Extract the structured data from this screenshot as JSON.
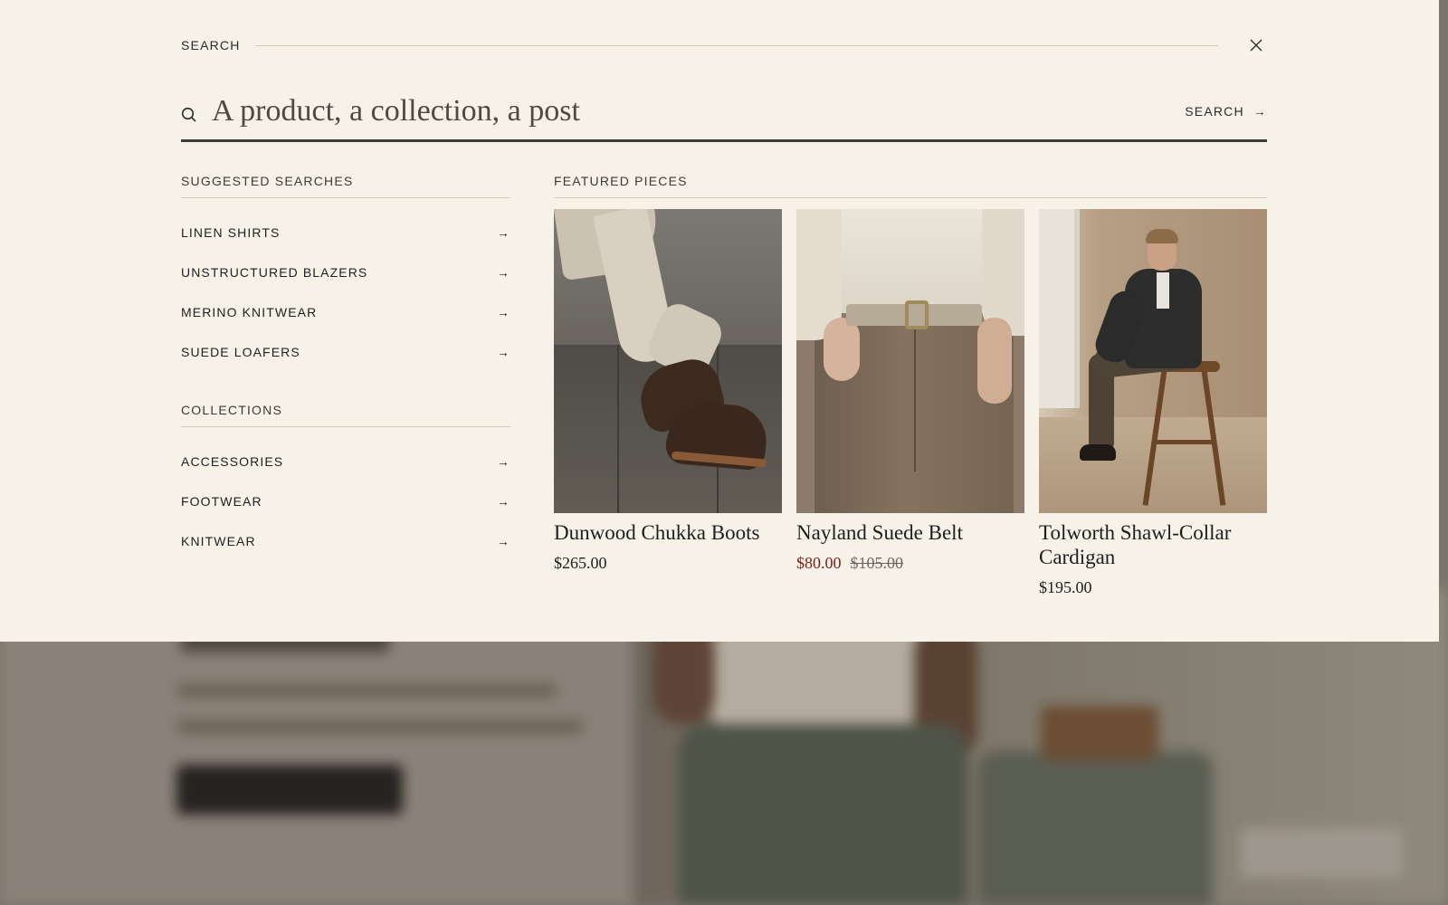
{
  "search_panel": {
    "title": "SEARCH",
    "input_placeholder": "A product, a collection, a post",
    "submit_label": "SEARCH",
    "submit_arrow": "→"
  },
  "suggested_searches": {
    "heading": "SUGGESTED SEARCHES",
    "items": [
      {
        "label": "LINEN SHIRTS",
        "arrow": "→"
      },
      {
        "label": "UNSTRUCTURED BLAZERS",
        "arrow": "→"
      },
      {
        "label": "MERINO KNITWEAR",
        "arrow": "→"
      },
      {
        "label": "SUEDE LOAFERS",
        "arrow": "→"
      }
    ]
  },
  "collections": {
    "heading": "COLLECTIONS",
    "items": [
      {
        "label": "ACCESSORIES",
        "arrow": "→"
      },
      {
        "label": "FOOTWEAR",
        "arrow": "→"
      },
      {
        "label": "KNITWEAR",
        "arrow": "→"
      }
    ]
  },
  "featured": {
    "heading": "FEATURED PIECES",
    "products": [
      {
        "name": "Dunwood Chukka Boots",
        "price": "$265.00"
      },
      {
        "name": "Nayland Suede Belt",
        "sale_price": "$80.00",
        "compare_price": "$105.00"
      },
      {
        "name": "Tolworth Shawl-Collar Cardigan",
        "price": "$195.00"
      }
    ]
  },
  "colors": {
    "panel_background": "#f6f2e8",
    "text": "#1f1f1f",
    "sale_price": "#7a1f1f",
    "search_underline": "#3b3e37",
    "overlay_background": "#7b746c"
  },
  "icons": [
    "search-icon",
    "close-icon",
    "arrow-right-icon"
  ]
}
